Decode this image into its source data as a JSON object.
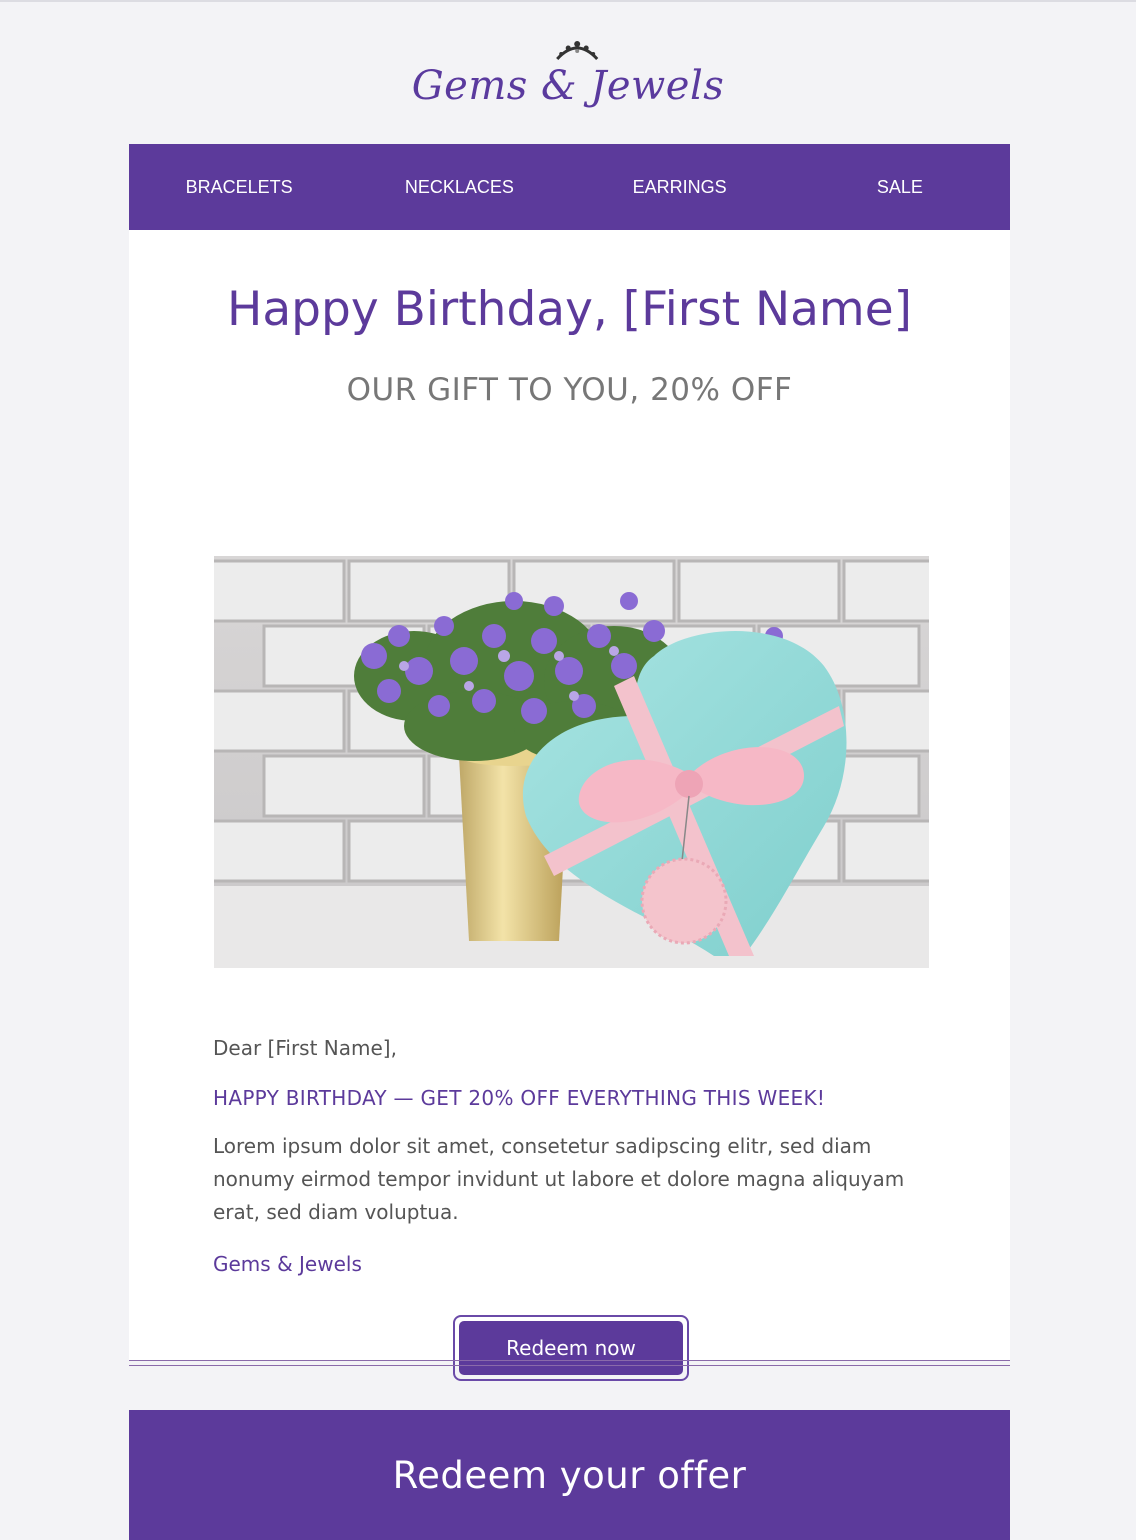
{
  "brand": {
    "logo_text": "Gems & Jewels",
    "accent_color": "#5c3a9b"
  },
  "nav": {
    "items": [
      {
        "label": "BRACELETS"
      },
      {
        "label": "NECKLACES"
      },
      {
        "label": "EARRINGS"
      },
      {
        "label": "SALE"
      }
    ]
  },
  "main": {
    "headline": "Happy Birthday, [First Name]",
    "subhead": "OUR GIFT TO YOU, 20% OFF",
    "greeting": "Dear [First Name],",
    "promo_line": "HAPPY BIRTHDAY — GET 20% OFF EVERYTHING THIS WEEK!",
    "body": "Lorem ipsum dolor sit amet, consetetur sadipscing elitr, sed diam nonumy eirmod tempor invidunt ut labore et dolore magna aliquyam erat, sed diam voluptua.",
    "signature": "Gems & Jewels",
    "cta_label": "Redeem now"
  },
  "footer": {
    "title": "Redeem your offer"
  }
}
